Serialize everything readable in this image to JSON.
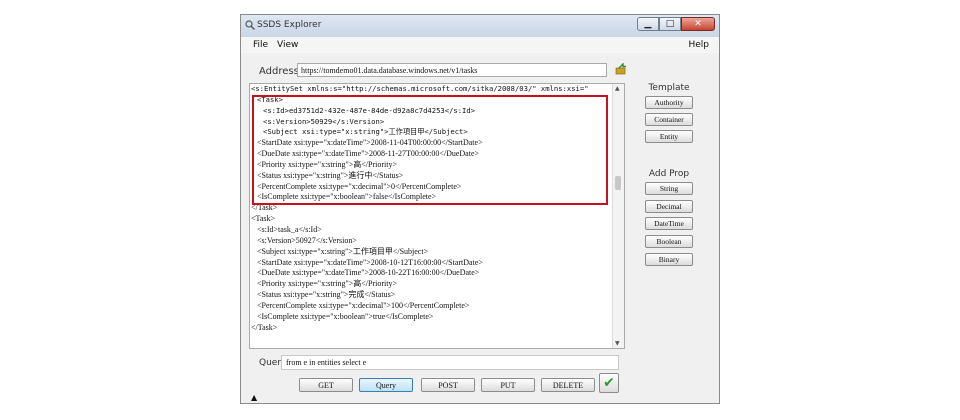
{
  "window": {
    "title": "SSDS Explorer",
    "controls": [
      "▁",
      "□",
      "✕"
    ]
  },
  "menu": {
    "file": "File",
    "view": "View",
    "help": "Help"
  },
  "address": {
    "label": "Address",
    "value": "https://tomdemo01.data.database.windows.net/v1/tasks"
  },
  "editor": {
    "lines": [
      {
        "text": "<s:EntitySet xmlns:s=\"http://schemas.microsoft.com/sitka/2008/03/\" xmlns:xsi=\"",
        "indent": 0,
        "font": "mono"
      },
      {
        "text": "<Task>",
        "indent": 1,
        "font": "mono"
      },
      {
        "text": "<s:Id>ed3751d2-432e-487e-84de-d92a8c7d4253</s:Id>",
        "indent": 2,
        "font": "mono"
      },
      {
        "text": "<s:Version>50929</s:Version>",
        "indent": 2,
        "font": "mono"
      },
      {
        "text": "<Subject xsi:type=\"x:string\">工作項目甲</Subject>",
        "indent": 2,
        "font": "mono"
      },
      {
        "text": "<StartDate xsi:type=\"x:dateTime\">2008-11-04T00:00:00</StartDate>",
        "indent": 1,
        "font": "serif"
      },
      {
        "text": "<DueDate xsi:type=\"x:dateTime\">2008-11-27T00:00:00</DueDate>",
        "indent": 1,
        "font": "serif"
      },
      {
        "text": "<Priority xsi:type=\"x:string\">高</Priority>",
        "indent": 1,
        "font": "serif"
      },
      {
        "text": "<Status xsi:type=\"x:string\">進行中</Status>",
        "indent": 1,
        "font": "serif"
      },
      {
        "text": "<PercentComplete xsi:type=\"x:decimal\">0</PercentComplete>",
        "indent": 1,
        "font": "serif"
      },
      {
        "text": "<IsComplete xsi:type=\"x:boolean\">false</IsComplete>",
        "indent": 1,
        "font": "serif"
      },
      {
        "text": "</Task>",
        "indent": 0,
        "font": "serif"
      },
      {
        "text": "<Task>",
        "indent": 0,
        "font": "serif"
      },
      {
        "text": "<s:Id>task_a</s:Id>",
        "indent": 1,
        "font": "serif"
      },
      {
        "text": "<s:Version>50927</s:Version>",
        "indent": 1,
        "font": "serif"
      },
      {
        "text": "<Subject xsi:type=\"x:string\">工作項目甲</Subject>",
        "indent": 1,
        "font": "serif"
      },
      {
        "text": "<StartDate xsi:type=\"x:dateTime\">2008-10-12T16:00:00</StartDate>",
        "indent": 1,
        "font": "serif"
      },
      {
        "text": "<DueDate xsi:type=\"x:dateTime\">2008-10-22T16:00:00</DueDate>",
        "indent": 1,
        "font": "serif"
      },
      {
        "text": "<Priority xsi:type=\"x:string\">高</Priority>",
        "indent": 1,
        "font": "serif"
      },
      {
        "text": "<Status xsi:type=\"x:string\">完成</Status>",
        "indent": 1,
        "font": "serif"
      },
      {
        "text": "<PercentComplete xsi:type=\"x:decimal\">100</PercentComplete>",
        "indent": 1,
        "font": "serif"
      },
      {
        "text": "<IsComplete xsi:type=\"x:boolean\">true</IsComplete>",
        "indent": 1,
        "font": "serif"
      },
      {
        "text": "</Task>",
        "indent": 0,
        "font": "serif"
      }
    ]
  },
  "template": {
    "heading": "Template",
    "buttons": [
      "Authority",
      "Container",
      "Entity"
    ]
  },
  "add_prop": {
    "heading": "Add Prop",
    "buttons": [
      "String",
      "Decimal",
      "DateTime",
      "Boolean",
      "Binary"
    ]
  },
  "query": {
    "label": "Query",
    "value": "from e in entities select e",
    "buttons": [
      "GET",
      "Query",
      "POST",
      "PUT",
      "DELETE"
    ],
    "active": "Query"
  },
  "colors": {
    "highlight": "#c4121e",
    "check": "#2e9a2e",
    "titlebar": "#c9d6e6"
  }
}
